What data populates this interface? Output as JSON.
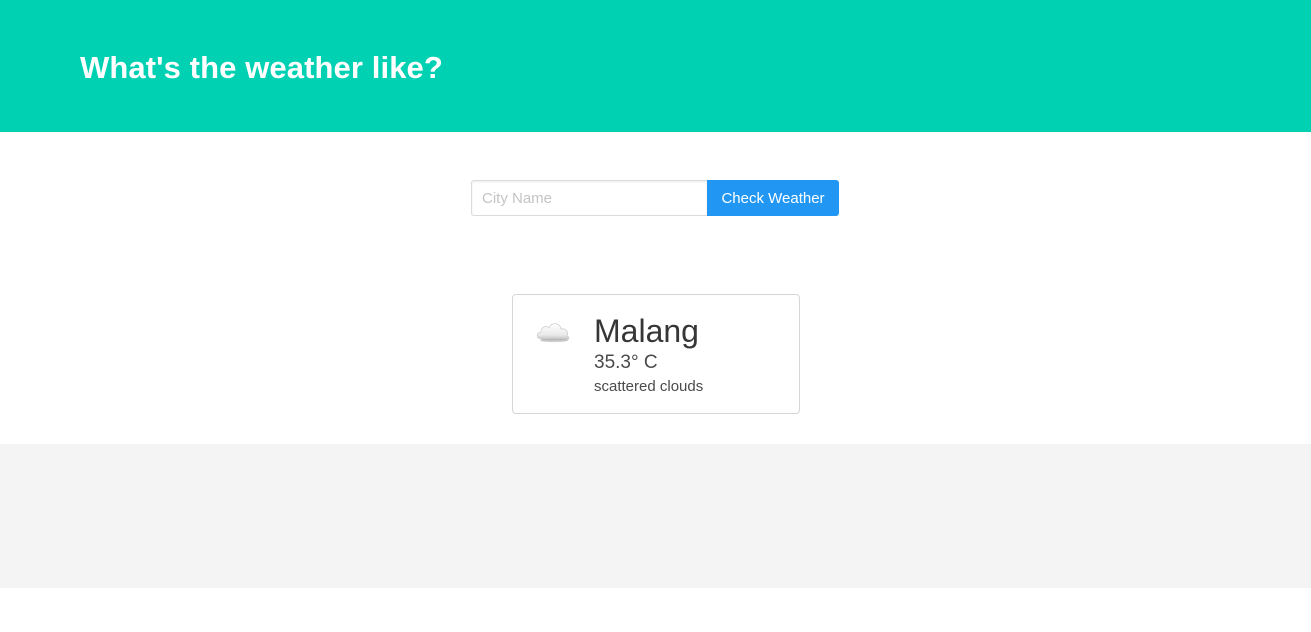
{
  "header": {
    "title": "What's the weather like?"
  },
  "search": {
    "placeholder": "City Name",
    "value": "",
    "button_label": "Check Weather"
  },
  "weather_card": {
    "icon": "cloud-icon",
    "city": "Malang",
    "temperature": "35.3° C",
    "description": "scattered clouds"
  },
  "colors": {
    "hero": "#00d1b2",
    "button": "#2196f3",
    "footer": "#f4f4f4"
  }
}
